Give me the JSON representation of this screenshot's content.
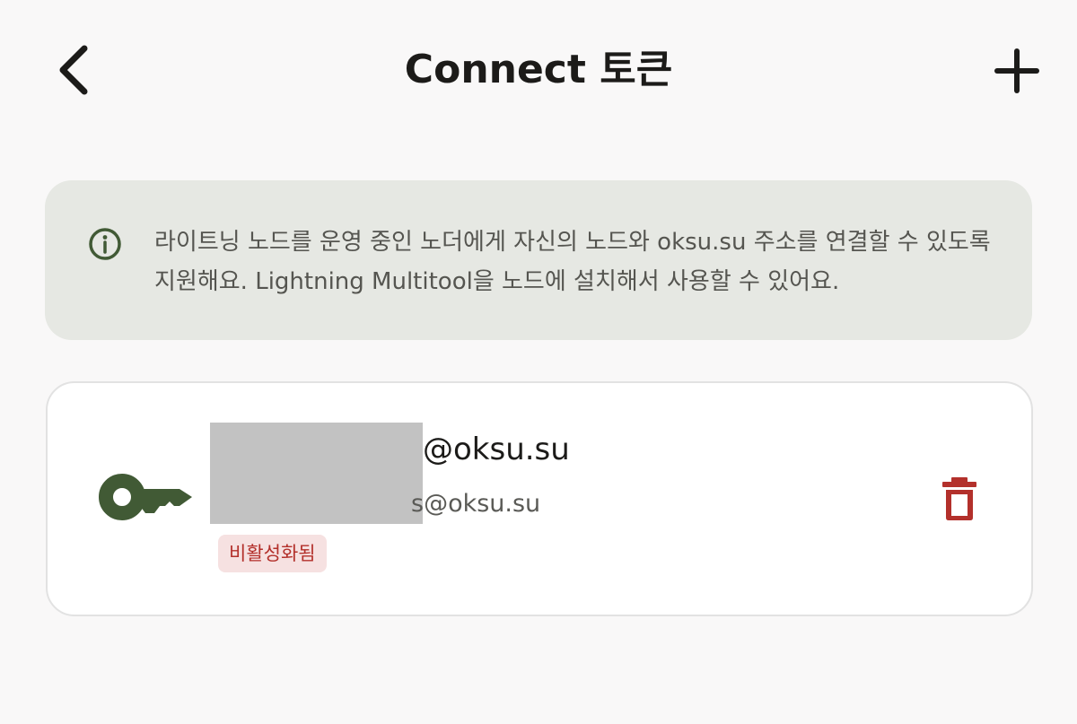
{
  "header": {
    "title": "Connect 토큰",
    "back_icon": "chevron-left-icon",
    "add_icon": "plus-icon"
  },
  "info": {
    "icon": "info-circle-icon",
    "text": "라이트닝 노드를 운영 중인 노더에게 자신의 노드와 oksu.su 주소를 연결할 수 있도록 지원해요. Lightning Multitool을 노드에 설치해서 사용할 수 있어요."
  },
  "token": {
    "icon": "key-icon",
    "primary_address": "@oksu.su",
    "secondary_address": "s@oksu.su",
    "status": "비활성화됨",
    "delete_icon": "trash-icon"
  },
  "colors": {
    "background": "#f9f8f8",
    "info_background": "#e6e8e3",
    "accent_green": "#415a35",
    "danger_red": "#b3302b",
    "badge_background": "#f6e1e1"
  }
}
